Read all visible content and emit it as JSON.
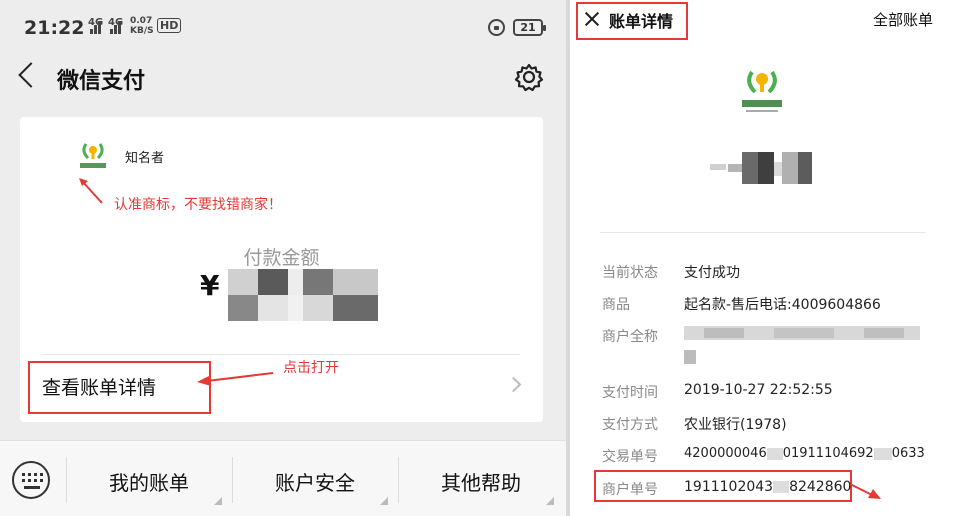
{
  "left": {
    "status": {
      "time": "21:22",
      "net1": "4G",
      "net2": "4G",
      "speed_value": "0.07",
      "speed_unit": "KB/S",
      "hd": "HD",
      "battery": "21"
    },
    "header": {
      "title": "微信支付"
    },
    "card": {
      "merchant_name": "知名者",
      "annotation_logo": "认准商标，不要找错商家！",
      "amount_label": "付款金额",
      "currency": "¥",
      "view_details": "查看账单详情",
      "annotation_open": "点击打开"
    },
    "menu": [
      {
        "label": "我的账单"
      },
      {
        "label": "账户安全"
      },
      {
        "label": "其他帮助"
      }
    ]
  },
  "right": {
    "header": {
      "title": "账单详情",
      "all_bills": "全部账单"
    },
    "rows": [
      {
        "label": "当前状态",
        "value": "支付成功"
      },
      {
        "label": "商品",
        "value": "起名款-售后电话:4009604866"
      },
      {
        "label": "商户全称",
        "value": ""
      },
      {
        "label": "支付时间",
        "value": "2019-10-27 22:52:55"
      },
      {
        "label": "支付方式",
        "value": "农业银行(1978)"
      },
      {
        "label": "交易单号",
        "value": "4200000046",
        "value_tail": "01911104692",
        "value_end": "0633"
      },
      {
        "label": "商户单号",
        "value": "1911102043",
        "value_tail": "8242860"
      }
    ]
  },
  "colors": {
    "annotation": "#e53935",
    "brand_green": "#4caf50",
    "brand_yellow": "#f5b400"
  },
  "icons": [
    "back-icon",
    "gear-icon",
    "keyboard-icon",
    "close-icon",
    "chevron-right-icon",
    "lock-icon",
    "battery-icon"
  ]
}
